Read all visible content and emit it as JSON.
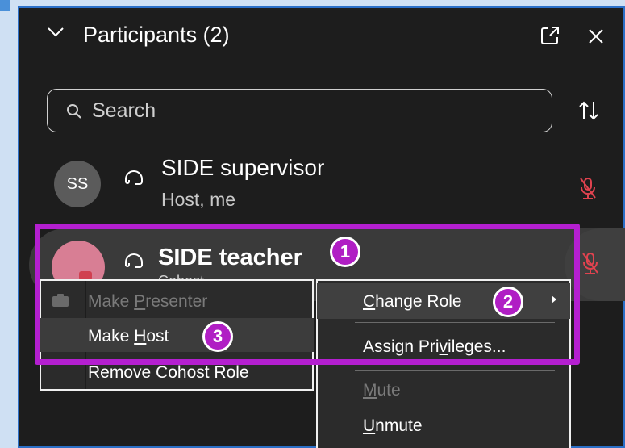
{
  "panel": {
    "title": "Participants (2)",
    "search_placeholder": "Search"
  },
  "participants": [
    {
      "initials": "SS",
      "name": "SIDE supervisor",
      "role": "Host, me"
    },
    {
      "initials": "",
      "name": "SIDE teacher",
      "role_fragment": "Cohost"
    }
  ],
  "context_menu_left": {
    "make_presenter": {
      "pre": "Make ",
      "u": "P",
      "post": "resenter"
    },
    "make_host": {
      "pre": "Make ",
      "u": "H",
      "post": "ost"
    },
    "remove_cohost": {
      "pre": "Remove C",
      "u": "o",
      "post": "host Role"
    }
  },
  "context_menu_right": {
    "change_role": {
      "pre": "",
      "u": "C",
      "post": "hange Role"
    },
    "assign_privileges": {
      "pre": "Assign Pri",
      "u": "v",
      "post": "ileges..."
    },
    "mute": {
      "pre": "",
      "u": "M",
      "post": "ute"
    },
    "unmute": {
      "pre": "",
      "u": "U",
      "post": "nmute"
    }
  },
  "callouts": {
    "one": "1",
    "two": "2",
    "three": "3"
  },
  "colors": {
    "accent": "#b41fd0",
    "muted_mic": "#e0434f",
    "panel_bg": "#1d1d1d"
  },
  "icons": [
    "chevron-down-icon",
    "popout-icon",
    "close-icon",
    "search-icon",
    "sort-icon",
    "headset-icon",
    "mic-muted-icon",
    "presenter-icon",
    "submenu-arrow-icon"
  ]
}
